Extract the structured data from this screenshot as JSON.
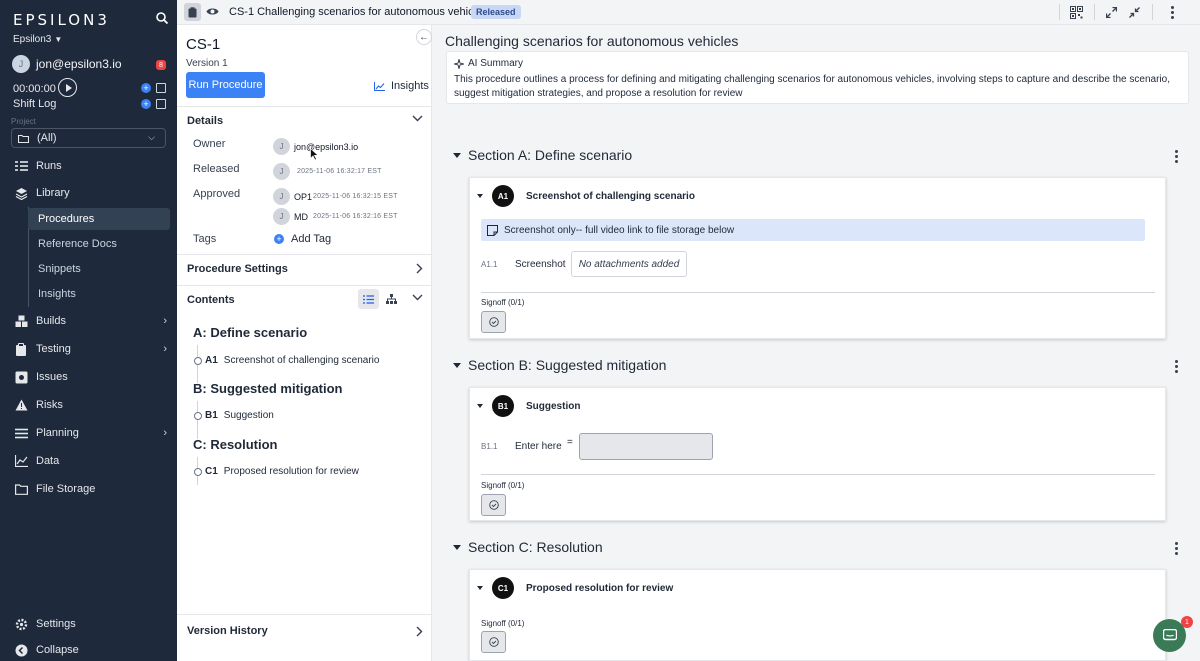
{
  "sidebar": {
    "logo": "EPSILON3",
    "org": "Epsilon3",
    "user_initial": "J",
    "user_email": "jon@epsilon3.io",
    "notification_count": "8",
    "timer": "00:00:00",
    "shift_log": "Shift Log",
    "project_label": "Project",
    "project_value": "(All)",
    "nav": {
      "runs": "Runs",
      "library": "Library",
      "procedures": "Procedures",
      "reference_docs": "Reference Docs",
      "snippets": "Snippets",
      "insights": "Insights",
      "builds": "Builds",
      "testing": "Testing",
      "issues": "Issues",
      "risks": "Risks",
      "planning": "Planning",
      "data": "Data",
      "file_storage": "File Storage",
      "settings": "Settings",
      "collapse": "Collapse"
    }
  },
  "topbar": {
    "title": "CS-1 Challenging scenarios for autonomous vehicles",
    "status": "Released"
  },
  "procedure": {
    "id": "CS-1",
    "version": "Version 1",
    "run_button": "Run Procedure",
    "insights": "Insights",
    "details_header": "Details",
    "owner_label": "Owner",
    "owner_initial": "J",
    "owner_email": "jon@epsilon3.io",
    "released_label": "Released",
    "released_initial": "J",
    "released_ts": "2025-11-06 16:32:17 EST",
    "approved_label": "Approved",
    "approvers": [
      {
        "initial": "J",
        "role": "OP1",
        "ts": "2025-11-06 16:32:15 EST"
      },
      {
        "initial": "J",
        "role": "MD",
        "ts": "2025-11-06 16:32:16 EST"
      }
    ],
    "tags_label": "Tags",
    "add_tag": "Add Tag",
    "settings_header": "Procedure Settings",
    "contents_header": "Contents",
    "version_history": "Version History",
    "contents": [
      {
        "section": "A: Define scenario",
        "steps": [
          {
            "id": "A1",
            "title": "Screenshot of challenging scenario"
          }
        ]
      },
      {
        "section": "B: Suggested mitigation",
        "steps": [
          {
            "id": "B1",
            "title": "Suggestion"
          }
        ]
      },
      {
        "section": "C: Resolution",
        "steps": [
          {
            "id": "C1",
            "title": "Proposed resolution for review"
          }
        ]
      }
    ]
  },
  "document": {
    "title": "Challenging scenarios for autonomous vehicles",
    "ai_summary_label": "AI Summary",
    "ai_summary_text": "This procedure outlines a process for defining and mitigating challenging scenarios for autonomous vehicles, involving steps to capture and describe the scenario, suggest mitigation strategies, and propose a resolution for review",
    "sections": [
      {
        "title": "Section A: Define scenario",
        "step_number": "A1",
        "step_title": "Screenshot of challenging scenario",
        "note": "Screenshot only-- full video link to file storage below",
        "field_id": "A1.1",
        "field_label": "Screenshot",
        "field_value": "No attachments added",
        "signoff": "Signoff (0/1)"
      },
      {
        "title": "Section B: Suggested mitigation",
        "step_number": "B1",
        "step_title": "Suggestion",
        "field_id": "B1.1",
        "field_label": "Enter here",
        "field_eq": "=",
        "signoff": "Signoff (0/1)"
      },
      {
        "title": "Section C: Resolution",
        "step_number": "C1",
        "step_title": "Proposed resolution for review",
        "signoff": "Signoff (0/1)"
      }
    ]
  },
  "chat": {
    "badge": "1"
  },
  "colors": {
    "sidebar_bg": "#1e2a3b",
    "accent": "#3b82f6",
    "released_badge": "#c7d7f5",
    "note_bg": "#dbe6fb",
    "chat_bg": "#3b7a57"
  }
}
